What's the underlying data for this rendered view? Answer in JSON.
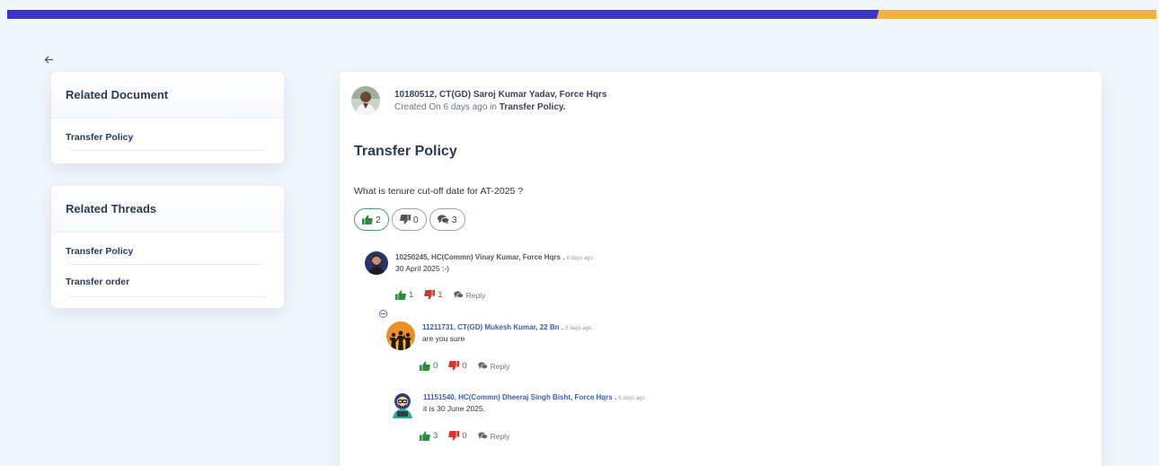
{
  "related_document": {
    "title": "Related Document",
    "items": [
      {
        "label": "Transfer Policy"
      }
    ]
  },
  "related_threads": {
    "title": "Related Threads",
    "items": [
      {
        "label": "Transfer Policy"
      },
      {
        "label": "Transfer order"
      }
    ]
  },
  "post": {
    "author": "10180512, CT(GD) Saroj Kumar Yadav, Force Hqrs",
    "created_prefix": "Created On 6 days ago in ",
    "category": "Transfer Policy.",
    "title": "Transfer Policy",
    "body": "What is tenure cut-off date for AT-2025 ?",
    "likes": "2",
    "dislikes": "0",
    "comments": "3"
  },
  "comments": [
    {
      "author": "10250245, HC(Commn) Vinay Kumar, Force Hqrs .",
      "time": "6 days ago .",
      "body": "30 April 2025 :-)",
      "likes": "1",
      "dislikes": "1",
      "reply_label": "Reply"
    },
    {
      "author": "11211731, CT(GD) Mukesh Kumar, 22 Bn .",
      "time": "6 days ago .",
      "body": "are you sure",
      "likes": "0",
      "dislikes": "0",
      "reply_label": "Reply"
    },
    {
      "author": "11151540, HC(Commn) Dheeraj Singh Bisht, Force Hqrs .",
      "time": "6 days ago .",
      "body": "it is 30 June 2025.",
      "likes": "3",
      "dislikes": "0",
      "reply_label": "Reply"
    }
  ],
  "colors": {
    "topbar_primary": "#3b34c7",
    "topbar_accent": "#f2b240",
    "like": "#2e8a3f",
    "dislike": "#d4362f",
    "link": "#3a5fb0"
  }
}
